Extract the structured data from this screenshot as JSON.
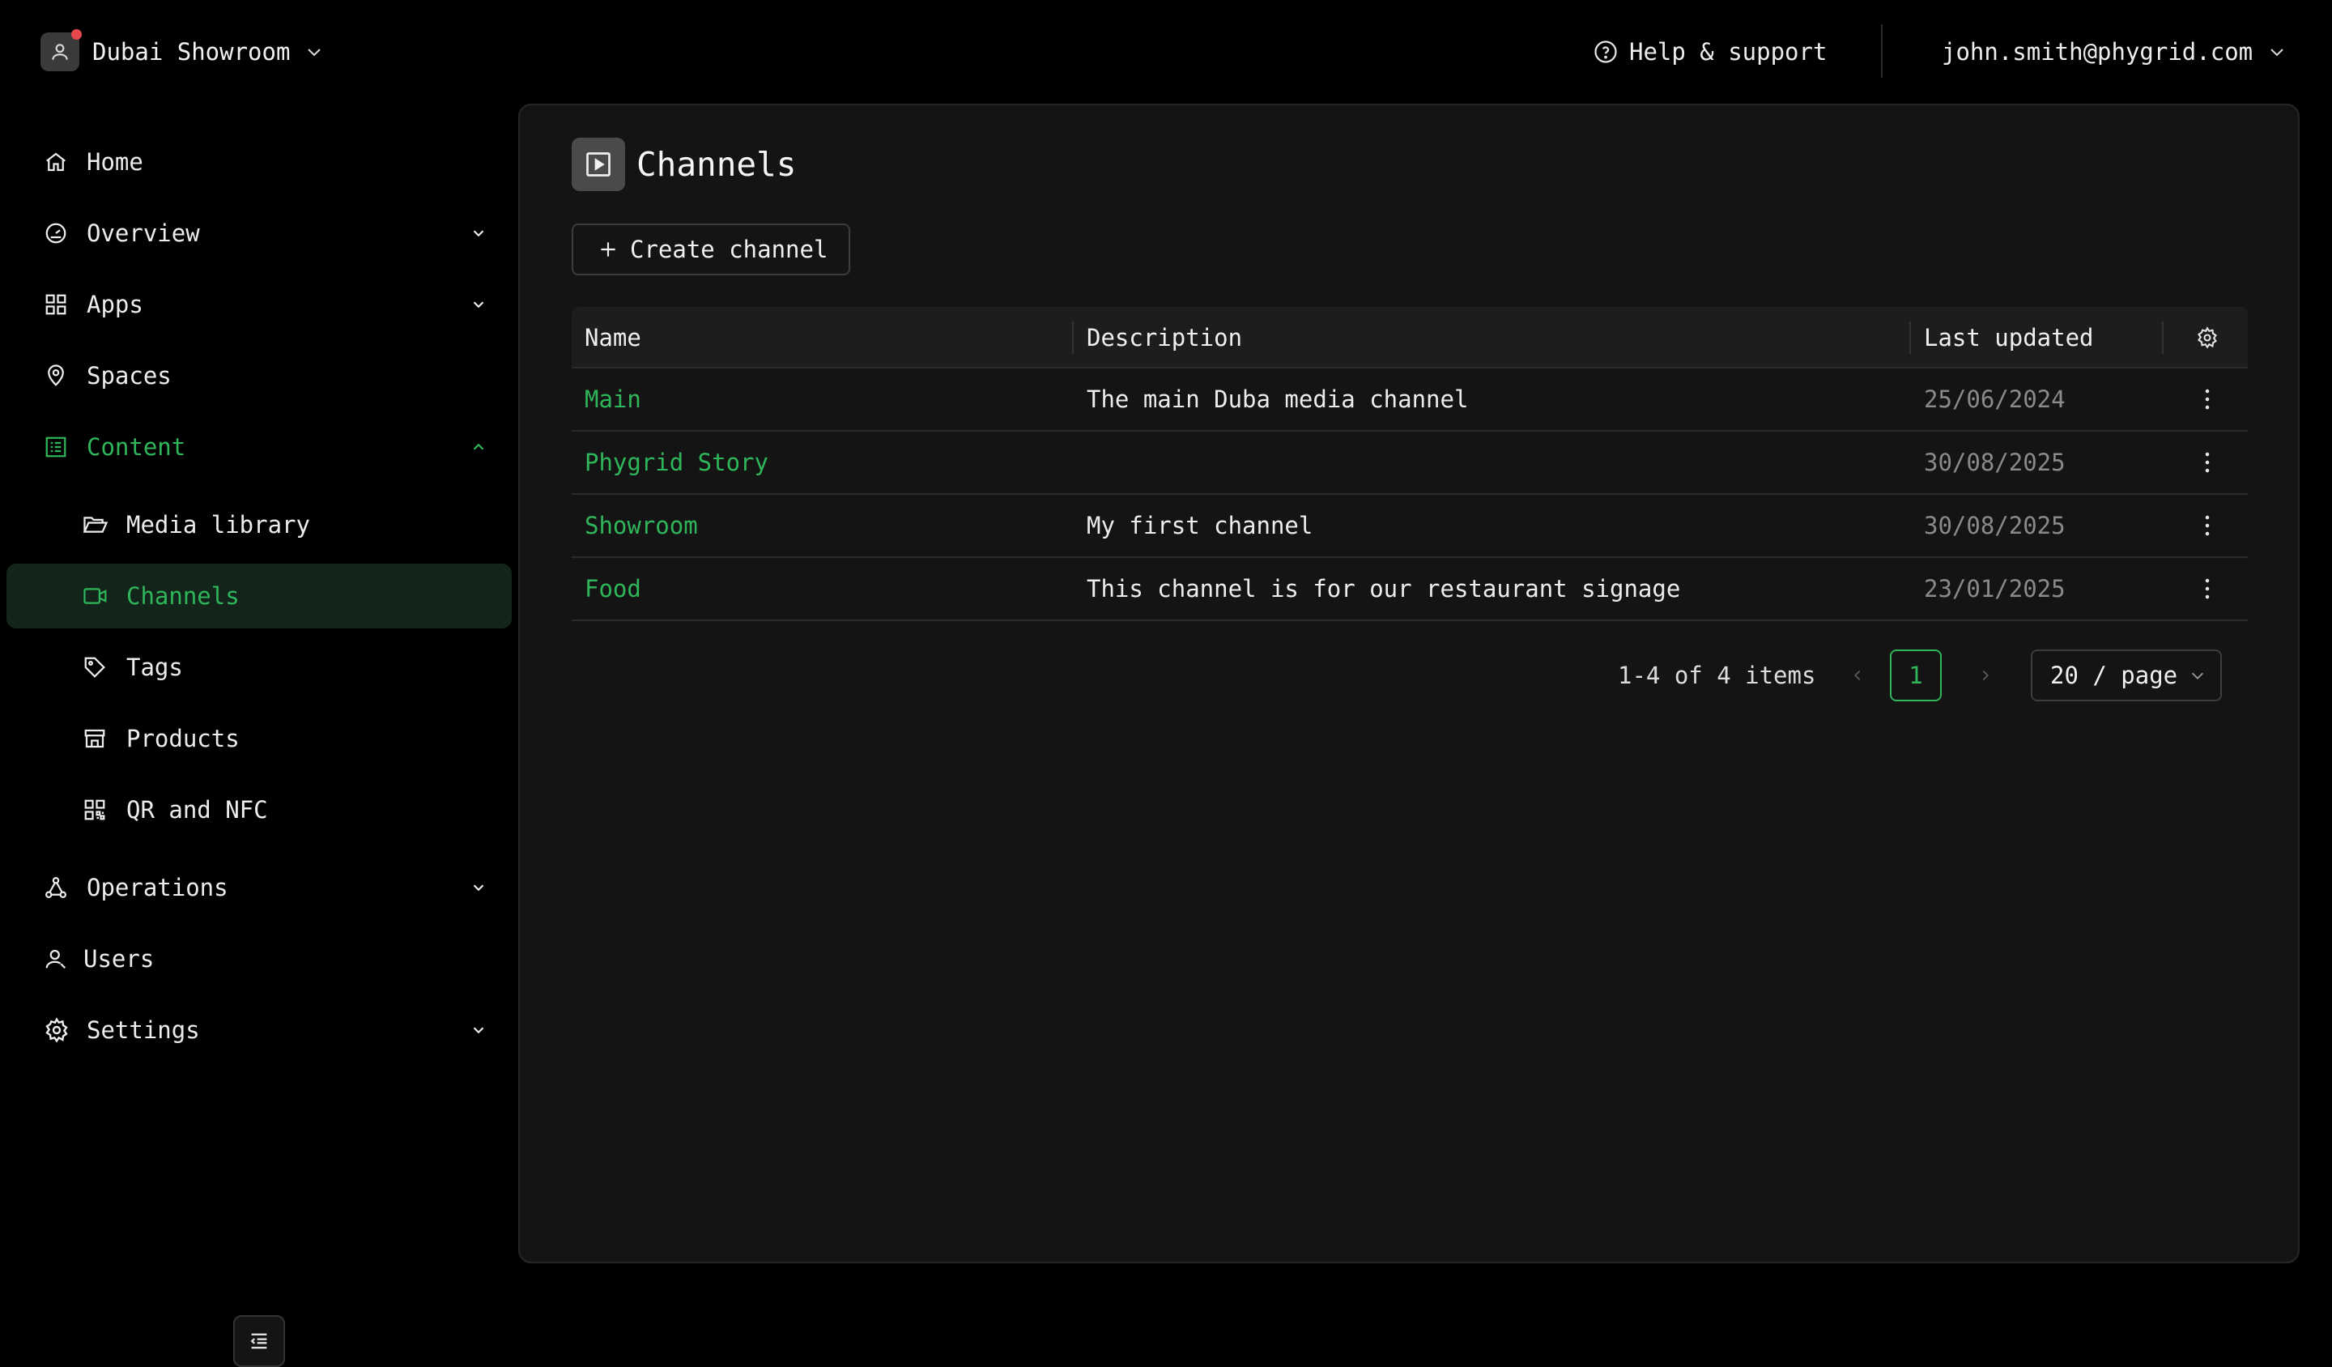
{
  "header": {
    "workspace_name": "Dubai Showroom",
    "help_label": "Help & support",
    "account_email": "john.smith@phygrid.com"
  },
  "sidebar": {
    "items": [
      {
        "label": "Home",
        "icon": "home-icon"
      },
      {
        "label": "Overview",
        "icon": "dashboard-icon",
        "expandable": true
      },
      {
        "label": "Apps",
        "icon": "grid-icon",
        "expandable": true
      },
      {
        "label": "Spaces",
        "icon": "location-pin-icon"
      },
      {
        "label": "Content",
        "icon": "content-icon",
        "expanded": true
      },
      {
        "label": "Media library",
        "icon": "folder-open-icon"
      },
      {
        "label": "Channels",
        "icon": "video-icon",
        "active": true
      },
      {
        "label": "Tags",
        "icon": "tag-icon"
      },
      {
        "label": "Products",
        "icon": "store-icon"
      },
      {
        "label": "QR and NFC",
        "icon": "qr-code-icon"
      },
      {
        "label": "Operations",
        "icon": "network-icon",
        "expandable": true
      },
      {
        "label": "Users",
        "icon": "user-icon"
      },
      {
        "label": "Settings",
        "icon": "gear-icon",
        "expandable": true
      }
    ]
  },
  "main": {
    "title": "Channels",
    "create_label": "Create channel",
    "table": {
      "columns": {
        "name": "Name",
        "description": "Description",
        "last_updated": "Last updated"
      },
      "rows": [
        {
          "name": "Main",
          "description": "The main Duba media channel",
          "last_updated": "25/06/2024"
        },
        {
          "name": "Phygrid Story",
          "description": "",
          "last_updated": "30/08/2025"
        },
        {
          "name": "Showroom",
          "description": "My first channel",
          "last_updated": "30/08/2025"
        },
        {
          "name": "Food",
          "description": "This channel is for our restaurant signage",
          "last_updated": "23/01/2025"
        }
      ]
    },
    "pagination": {
      "summary": "1-4 of 4 items",
      "current_page": "1",
      "page_size": "20 / page"
    }
  },
  "colors": {
    "accent": "#2fb65a",
    "background": "#000000",
    "panel": "#141414",
    "active_bg": "#13251a"
  }
}
